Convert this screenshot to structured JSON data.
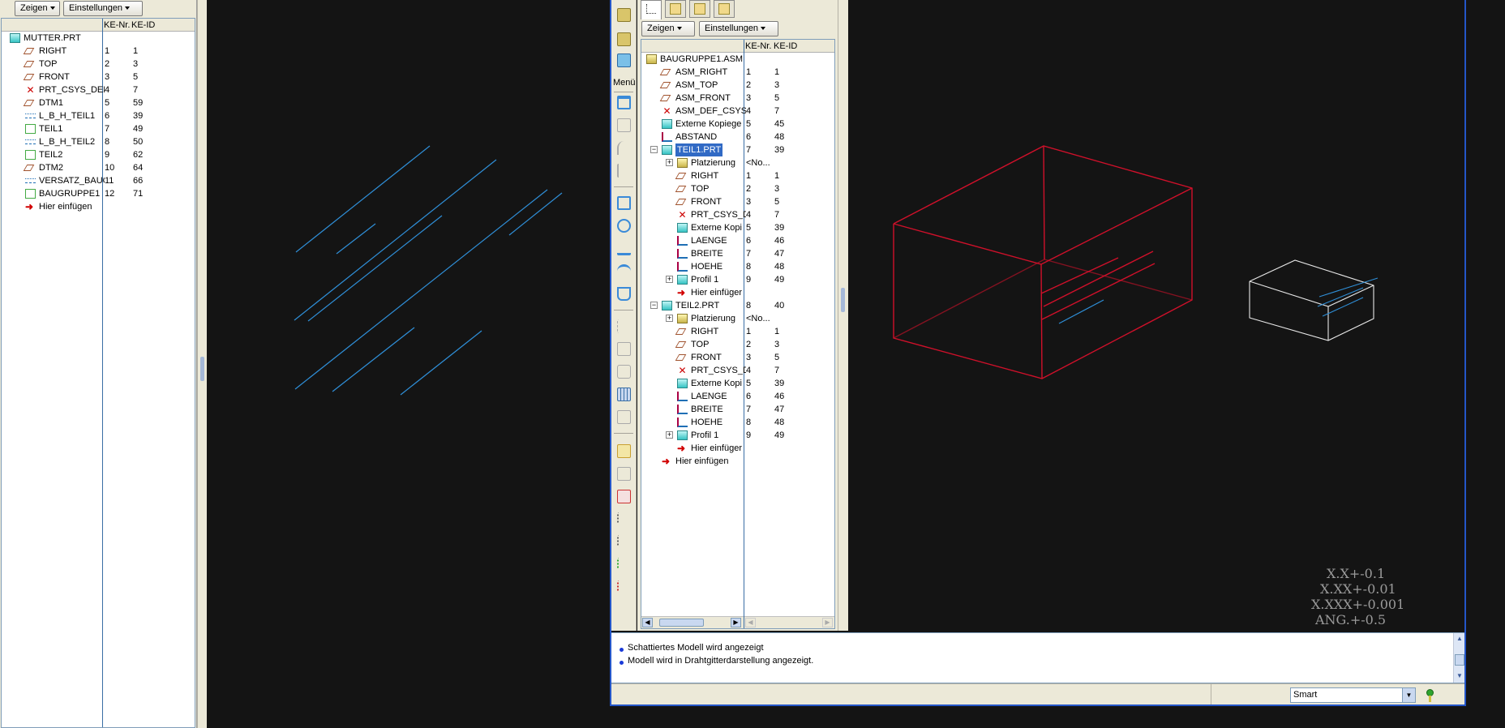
{
  "left_panel": {
    "show_button": "Zeigen",
    "settings_button": "Einstellungen",
    "col_nr": "KE-Nr.",
    "col_id": "KE-ID",
    "rows": [
      {
        "label": "MUTTER.PRT",
        "nr": "",
        "id": "",
        "icon": "part-icon"
      },
      {
        "label": "RIGHT",
        "nr": "1",
        "id": "1",
        "icon": "datum-plane-icon"
      },
      {
        "label": "TOP",
        "nr": "2",
        "id": "3",
        "icon": "datum-plane-icon"
      },
      {
        "label": "FRONT",
        "nr": "3",
        "id": "5",
        "icon": "datum-plane-icon"
      },
      {
        "label": "PRT_CSYS_DEF",
        "nr": "4",
        "id": "7",
        "icon": "csys-icon"
      },
      {
        "label": "DTM1",
        "nr": "5",
        "id": "59",
        "icon": "datum-plane-icon"
      },
      {
        "label": "L_B_H_TEIL1",
        "nr": "6",
        "id": "39",
        "icon": "curve-icon"
      },
      {
        "label": "TEIL1",
        "nr": "7",
        "id": "49",
        "icon": "feature-icon"
      },
      {
        "label": "L_B_H_TEIL2",
        "nr": "8",
        "id": "50",
        "icon": "curve-icon"
      },
      {
        "label": "TEIL2",
        "nr": "9",
        "id": "62",
        "icon": "feature-icon"
      },
      {
        "label": "DTM2",
        "nr": "10",
        "id": "64",
        "icon": "datum-plane-icon"
      },
      {
        "label": "VERSATZ_BAUG",
        "nr": "11",
        "id": "66",
        "icon": "curve-icon"
      },
      {
        "label": "BAUGRUPPE1",
        "nr": "12",
        "id": "71",
        "icon": "feature-icon"
      },
      {
        "label": "Hier einfügen",
        "nr": "",
        "id": "",
        "icon": "insert-arrow-icon"
      }
    ]
  },
  "asm_panel": {
    "show_button": "Zeigen",
    "settings_button": "Einstellungen",
    "col_nr": "KE-Nr.",
    "col_id": "KE-ID",
    "menu_label": "Menü",
    "rows": [
      {
        "label": "BAUGRUPPE1.ASM",
        "nr": "",
        "id": "",
        "icon": "assembly-icon",
        "indent": 0
      },
      {
        "label": "ASM_RIGHT",
        "nr": "1",
        "id": "1",
        "icon": "datum-plane-icon",
        "indent": 1
      },
      {
        "label": "ASM_TOP",
        "nr": "2",
        "id": "3",
        "icon": "datum-plane-icon",
        "indent": 1
      },
      {
        "label": "ASM_FRONT",
        "nr": "3",
        "id": "5",
        "icon": "datum-plane-icon",
        "indent": 1
      },
      {
        "label": "ASM_DEF_CSYS",
        "nr": "4",
        "id": "7",
        "icon": "csys-icon",
        "indent": 1
      },
      {
        "label": "Externe Kopiege",
        "nr": "5",
        "id": "45",
        "icon": "copy-geom-icon",
        "indent": 1
      },
      {
        "label": "ABSTAND",
        "nr": "6",
        "id": "48",
        "icon": "sketch-icon",
        "indent": 1
      },
      {
        "label": "TEIL1.PRT",
        "nr": "7",
        "id": "39",
        "icon": "part-icon",
        "indent": 1,
        "selected": true,
        "expand": "-"
      },
      {
        "label": "Platzierung",
        "nr": "<No...",
        "id": "",
        "icon": "placement-icon",
        "indent": 2,
        "expand": "+"
      },
      {
        "label": "RIGHT",
        "nr": "1",
        "id": "1",
        "icon": "datum-plane-icon",
        "indent": 2
      },
      {
        "label": "TOP",
        "nr": "2",
        "id": "3",
        "icon": "datum-plane-icon",
        "indent": 2
      },
      {
        "label": "FRONT",
        "nr": "3",
        "id": "5",
        "icon": "datum-plane-icon",
        "indent": 2
      },
      {
        "label": "PRT_CSYS_D",
        "nr": "4",
        "id": "7",
        "icon": "csys-icon",
        "indent": 2
      },
      {
        "label": "Externe Kopi",
        "nr": "5",
        "id": "39",
        "icon": "copy-geom-icon",
        "indent": 2
      },
      {
        "label": "LAENGE",
        "nr": "6",
        "id": "46",
        "icon": "sketch-icon",
        "indent": 2
      },
      {
        "label": "BREITE",
        "nr": "7",
        "id": "47",
        "icon": "sketch-icon",
        "indent": 2
      },
      {
        "label": "HOEHE",
        "nr": "8",
        "id": "48",
        "icon": "sketch-icon",
        "indent": 2
      },
      {
        "label": "Profil 1",
        "nr": "9",
        "id": "49",
        "icon": "extrude-icon",
        "indent": 2,
        "expand": "+"
      },
      {
        "label": "Hier einfüger",
        "nr": "",
        "id": "",
        "icon": "insert-arrow-icon",
        "indent": 2
      },
      {
        "label": "TEIL2.PRT",
        "nr": "8",
        "id": "40",
        "icon": "part-icon",
        "indent": 1,
        "expand": "-"
      },
      {
        "label": "Platzierung",
        "nr": "<No...",
        "id": "",
        "icon": "placement-icon",
        "indent": 2,
        "expand": "+"
      },
      {
        "label": "RIGHT",
        "nr": "1",
        "id": "1",
        "icon": "datum-plane-icon",
        "indent": 2
      },
      {
        "label": "TOP",
        "nr": "2",
        "id": "3",
        "icon": "datum-plane-icon",
        "indent": 2
      },
      {
        "label": "FRONT",
        "nr": "3",
        "id": "5",
        "icon": "datum-plane-icon",
        "indent": 2
      },
      {
        "label": "PRT_CSYS_D",
        "nr": "4",
        "id": "7",
        "icon": "csys-icon",
        "indent": 2
      },
      {
        "label": "Externe Kopi",
        "nr": "5",
        "id": "39",
        "icon": "copy-geom-icon",
        "indent": 2
      },
      {
        "label": "LAENGE",
        "nr": "6",
        "id": "46",
        "icon": "sketch-icon",
        "indent": 2
      },
      {
        "label": "BREITE",
        "nr": "7",
        "id": "47",
        "icon": "sketch-icon",
        "indent": 2
      },
      {
        "label": "HOEHE",
        "nr": "8",
        "id": "48",
        "icon": "sketch-icon",
        "indent": 2
      },
      {
        "label": "Profil 1",
        "nr": "9",
        "id": "49",
        "icon": "extrude-icon",
        "indent": 2,
        "expand": "+"
      },
      {
        "label": "Hier einfüger",
        "nr": "",
        "id": "",
        "icon": "insert-arrow-icon",
        "indent": 2
      },
      {
        "label": "Hier einfügen",
        "nr": "",
        "id": "",
        "icon": "insert-arrow-icon",
        "indent": 1
      }
    ]
  },
  "messages": [
    "Schattiertes Modell wird angezeigt",
    "Modell wird in Drahtgitterdarstellung angezeigt."
  ],
  "status": {
    "filter_value": "Smart"
  },
  "tolerances": [
    "X.X+-0.1",
    "X.XX+-0.01",
    "X.XXX+-0.001",
    "ANG.+-0.5"
  ],
  "colors": {
    "background": "#141414",
    "wire_blue": "#2f8fd8",
    "wire_red": "#d0102a",
    "wire_white": "#e8e8e8",
    "selection": "#316ac5"
  }
}
